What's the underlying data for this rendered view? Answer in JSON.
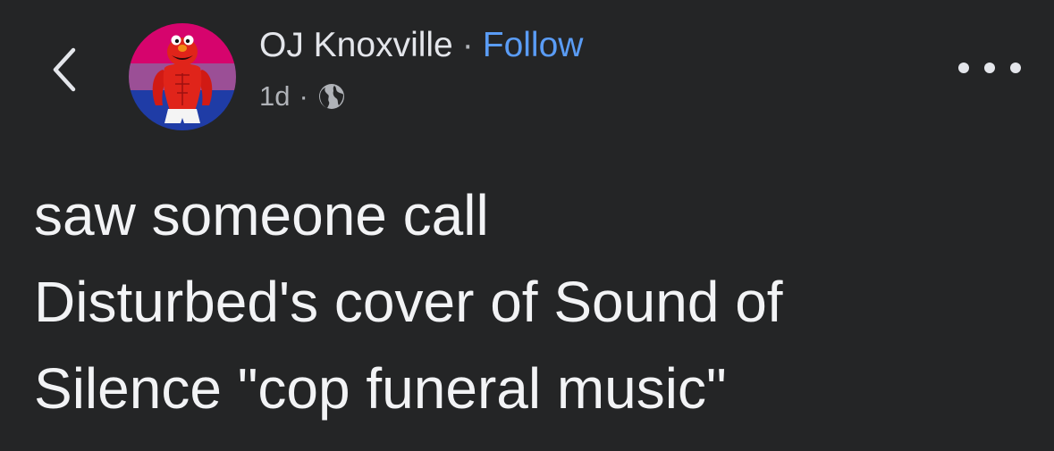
{
  "header": {
    "back_icon": "chevron-left-icon",
    "avatar": "elmo-avatar",
    "author_name": "OJ Knoxville",
    "separator": "·",
    "follow_label": "Follow",
    "timestamp": "1d",
    "meta_separator": "·",
    "privacy_icon": "globe-icon",
    "more_icon": "more-horizontal-icon"
  },
  "post": {
    "text": "saw someone call\nDisturbed's cover of Sound of\nSilence \"cop funeral music\""
  },
  "colors": {
    "background": "#242526",
    "text": "#e4e6eb",
    "secondary_text": "#b0b3b8",
    "link": "#5a9cf5"
  }
}
